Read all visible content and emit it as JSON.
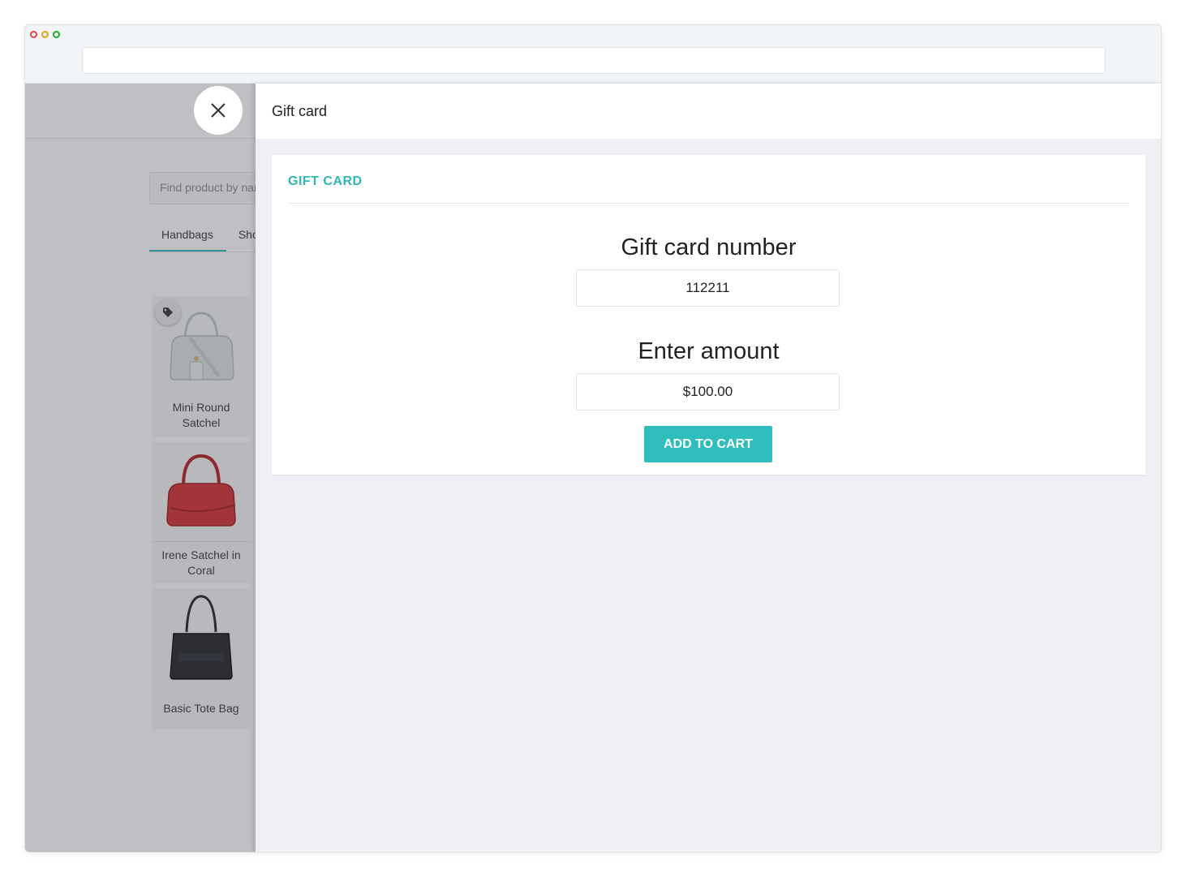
{
  "colors": {
    "accent": "#2fb7b8",
    "button": "#2fbdbd",
    "panel_bg": "#eef0f3"
  },
  "app": {
    "search_placeholder": "Find product by name",
    "tabs": [
      {
        "label": "Handbags"
      },
      {
        "label": "Shoes"
      }
    ],
    "products": [
      {
        "name": "Mini Round Satchel",
        "icon": "white-handbag-image",
        "badge_icon": "tag-icon"
      },
      {
        "name": "Irene Satchel in Coral",
        "icon": "red-handbag-image"
      },
      {
        "name": "Basic Tote Bag",
        "icon": "black-tote-image"
      }
    ]
  },
  "panel": {
    "title": "Gift card",
    "section_title": "GIFT CARD",
    "number_label": "Gift card number",
    "number_value": "112211",
    "amount_label": "Enter amount",
    "amount_value": "$100.00",
    "add_button": "ADD TO CART",
    "close_icon": "close-icon"
  }
}
